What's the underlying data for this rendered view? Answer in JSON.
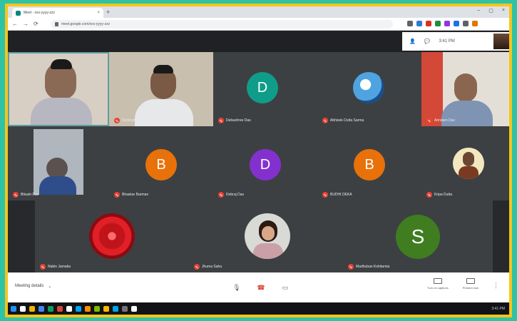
{
  "browser": {
    "tab_title": "Meet - xxx-yyyy-zzz",
    "tab_close": "×",
    "new_tab": "+",
    "window_controls": [
      "–",
      "▢",
      "×"
    ],
    "nav": [
      "←",
      "→",
      "⟳"
    ],
    "url": "meet.google.com/xxx-yyyy-zzz",
    "extension_colors": [
      "#5f6368",
      "#2b7bd6",
      "#d93025",
      "#1e8e3e",
      "#9334e6",
      "#1a73e8",
      "#5f6368",
      "#e37400"
    ]
  },
  "meet_header": {
    "people_icon": "people-icon",
    "chat_icon": "chat-icon",
    "time": "3:41 PM"
  },
  "participants": [
    {
      "name": "",
      "type": "video",
      "highlight": true
    },
    {
      "name": "Santosh Kumar",
      "type": "video"
    },
    {
      "name": "Debashree Das",
      "type": "avatar",
      "letter": "D",
      "color": "#0f9d8a"
    },
    {
      "name": "Abhisek Dutta Sarma",
      "type": "photo"
    },
    {
      "name": "Arindam Das",
      "type": "video"
    },
    {
      "name": "Bikash Das",
      "type": "video"
    },
    {
      "name": "Bhaskar Barman",
      "type": "avatar",
      "letter": "B",
      "color": "#e8710a"
    },
    {
      "name": "Debraj Das",
      "type": "avatar",
      "letter": "D",
      "color": "#8430ce"
    },
    {
      "name": "BUDHI DEKA",
      "type": "avatar",
      "letter": "B",
      "color": "#e8710a"
    },
    {
      "name": "Kripa Dutta",
      "type": "photo"
    },
    {
      "name": "Nabin Jamatia",
      "type": "photo_flower"
    },
    {
      "name": "Jhuma Saha",
      "type": "photo"
    },
    {
      "name": "Madhuban Kshitarnia",
      "type": "avatar",
      "letter": "S",
      "color": "#3f7d20"
    }
  ],
  "controls": {
    "meeting_details": "Meeting details",
    "details_chevron": "⌄",
    "mic": "🎙",
    "hangup": "☎",
    "camera": "▭",
    "captions": "Turn on captions",
    "present": "Present now",
    "more": "⋮"
  },
  "taskbar": {
    "clock": "3:41 PM",
    "icon_colors": [
      "#1e90ff",
      "#ffffff",
      "#f4b400",
      "#4285f4",
      "#0f9d58",
      "#db4437",
      "#ffffff",
      "#00a4ef",
      "#ff8c00",
      "#7cbb00",
      "#ffb900",
      "#00a4ef",
      "#737373",
      "#ffffff"
    ]
  }
}
